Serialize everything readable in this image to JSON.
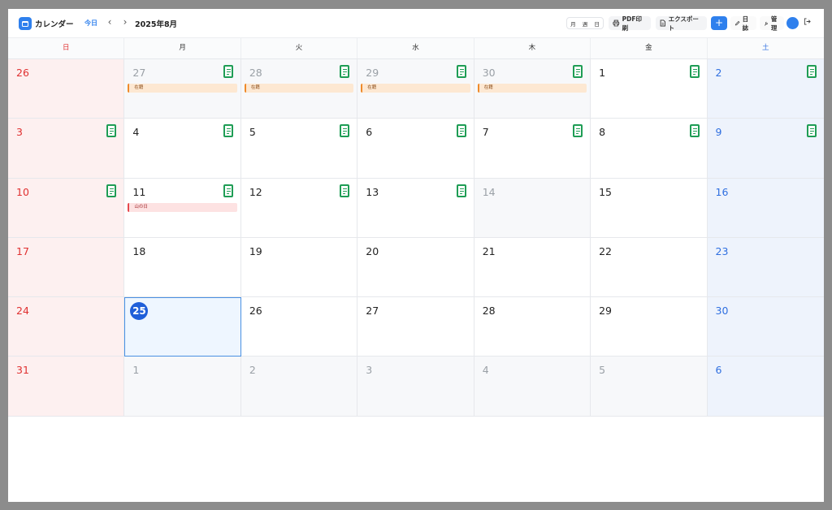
{
  "header": {
    "app_title": "カレンダー",
    "today_label": "今日",
    "prev_label": "‹",
    "next_label": "›",
    "current_month": "2025年8月",
    "view_modes": [
      "月",
      "週",
      "日"
    ],
    "print_label": "PDF印刷",
    "export_label": "エクスポート",
    "add_label": "+",
    "diary_label": "日誌",
    "manage_label": "管理",
    "logout_icon": "logout-icon"
  },
  "weekdays": [
    "日",
    "月",
    "火",
    "水",
    "木",
    "金",
    "土"
  ],
  "weeks": [
    [
      {
        "day": "26",
        "other": true,
        "events": []
      },
      {
        "day": "27",
        "other": true,
        "memo": true,
        "events": [
          {
            "label": "在籍",
            "type": "work"
          }
        ]
      },
      {
        "day": "28",
        "other": true,
        "memo": true,
        "events": [
          {
            "label": "在籍",
            "type": "work"
          }
        ]
      },
      {
        "day": "29",
        "other": true,
        "memo": true,
        "events": [
          {
            "label": "在籍",
            "type": "work"
          }
        ]
      },
      {
        "day": "30",
        "other": true,
        "memo": true,
        "events": [
          {
            "label": "在籍",
            "type": "work"
          }
        ]
      },
      {
        "day": "1",
        "memo": true,
        "events": []
      },
      {
        "day": "2",
        "memo": true,
        "events": []
      }
    ],
    [
      {
        "day": "3",
        "memo": true,
        "events": []
      },
      {
        "day": "4",
        "memo": true,
        "events": []
      },
      {
        "day": "5",
        "memo": true,
        "events": []
      },
      {
        "day": "6",
        "memo": true,
        "events": []
      },
      {
        "day": "7",
        "memo": true,
        "events": []
      },
      {
        "day": "8",
        "memo": true,
        "events": []
      },
      {
        "day": "9",
        "memo": true,
        "events": []
      }
    ],
    [
      {
        "day": "10",
        "memo": true,
        "events": []
      },
      {
        "day": "11",
        "memo": true,
        "events": [
          {
            "label": "山の日",
            "type": "holiday"
          }
        ]
      },
      {
        "day": "12",
        "memo": true,
        "events": []
      },
      {
        "day": "13",
        "memo": true,
        "events": []
      },
      {
        "day": "14",
        "grey": true,
        "events": []
      },
      {
        "day": "15",
        "events": []
      },
      {
        "day": "16",
        "events": []
      }
    ],
    [
      {
        "day": "17",
        "events": []
      },
      {
        "day": "18",
        "events": []
      },
      {
        "day": "19",
        "events": []
      },
      {
        "day": "20",
        "events": []
      },
      {
        "day": "21",
        "events": []
      },
      {
        "day": "22",
        "events": []
      },
      {
        "day": "23",
        "events": []
      }
    ],
    [
      {
        "day": "24",
        "events": []
      },
      {
        "day": "25",
        "today": true,
        "events": []
      },
      {
        "day": "26",
        "events": []
      },
      {
        "day": "27",
        "events": []
      },
      {
        "day": "28",
        "events": []
      },
      {
        "day": "29",
        "events": []
      },
      {
        "day": "30",
        "events": []
      }
    ],
    [
      {
        "day": "31",
        "events": []
      },
      {
        "day": "1",
        "other": true,
        "events": []
      },
      {
        "day": "2",
        "other": true,
        "events": []
      },
      {
        "day": "3",
        "other": true,
        "events": []
      },
      {
        "day": "4",
        "other": true,
        "events": []
      },
      {
        "day": "5",
        "other": true,
        "events": []
      },
      {
        "day": "6",
        "other": true,
        "events": []
      }
    ]
  ],
  "colors": {
    "accent": "#2f80ed",
    "sunday": "#e03131",
    "saturday": "#2f6fe0",
    "memo": "#1f9d55",
    "work_event": "#ef8a2a",
    "holiday_event": "#e5484d"
  }
}
